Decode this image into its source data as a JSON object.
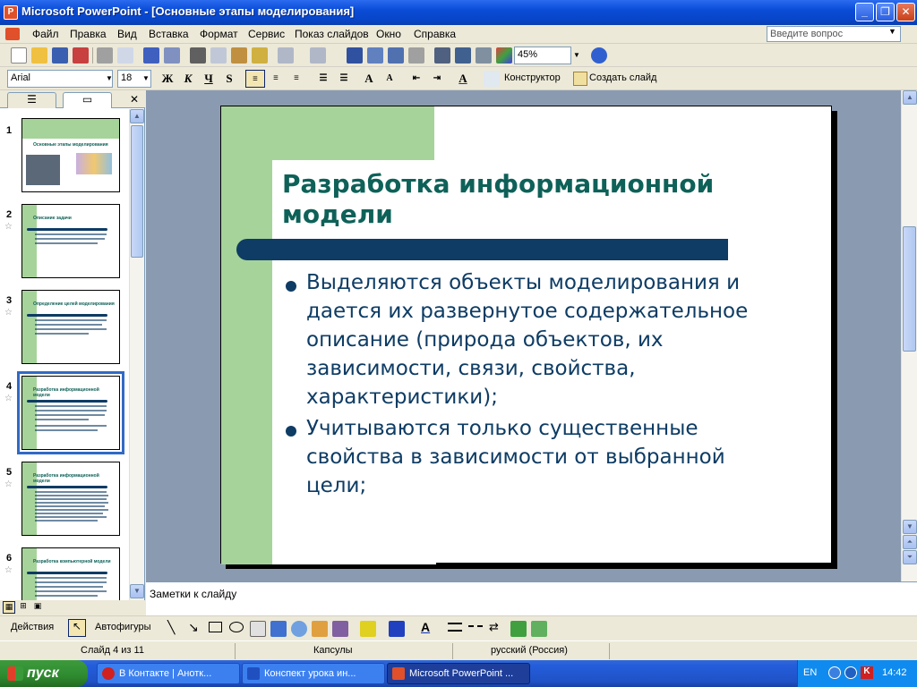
{
  "window": {
    "title": "Microsoft PowerPoint - [Основные этапы моделирования]"
  },
  "menu": [
    "Файл",
    "Правка",
    "Вид",
    "Вставка",
    "Формат",
    "Сервис",
    "Показ слайдов",
    "Окно",
    "Справка"
  ],
  "help_placeholder": "Введите вопрос",
  "toolbar": {
    "zoom": "45%"
  },
  "format_toolbar": {
    "font": "Arial",
    "size": "18",
    "bold": "Ж",
    "italic": "К",
    "underline": "Ч",
    "shadow": "S",
    "designer": "Конструктор",
    "new_slide": "Создать слайд"
  },
  "thumbnails": [
    {
      "num": "1",
      "title": "Основные этапы моделирования"
    },
    {
      "num": "2",
      "title": "Описание задачи"
    },
    {
      "num": "3",
      "title": "Определение целей моделирования"
    },
    {
      "num": "4",
      "title": "Разработка информационной модели"
    },
    {
      "num": "5",
      "title": "Разработка информационной модели"
    },
    {
      "num": "6",
      "title": "Разработка компьютерной модели"
    }
  ],
  "slide": {
    "title": "Разработка информационной модели",
    "bullets": [
      "Выделяются объекты моделирования и дается их развернутое содержательное описание (природа объектов, их зависимости, связи, свойства, характеристики);",
      "Учитываются только существенные свойства в зависимости от выбранной цели;"
    ]
  },
  "notes_placeholder": "Заметки к слайду",
  "drawbar": {
    "actions": "Действия",
    "autoshapes": "Автофигуры"
  },
  "status": {
    "slide": "Слайд 4 из 11",
    "design": "Капсулы",
    "language": "русский (Россия)"
  },
  "taskbar": {
    "start": "пуск",
    "tasks": [
      "В Контакте | Анотк...",
      "Конспект урока  ин...",
      "Microsoft PowerPoint ..."
    ],
    "lang": "EN",
    "time": "14:42"
  }
}
